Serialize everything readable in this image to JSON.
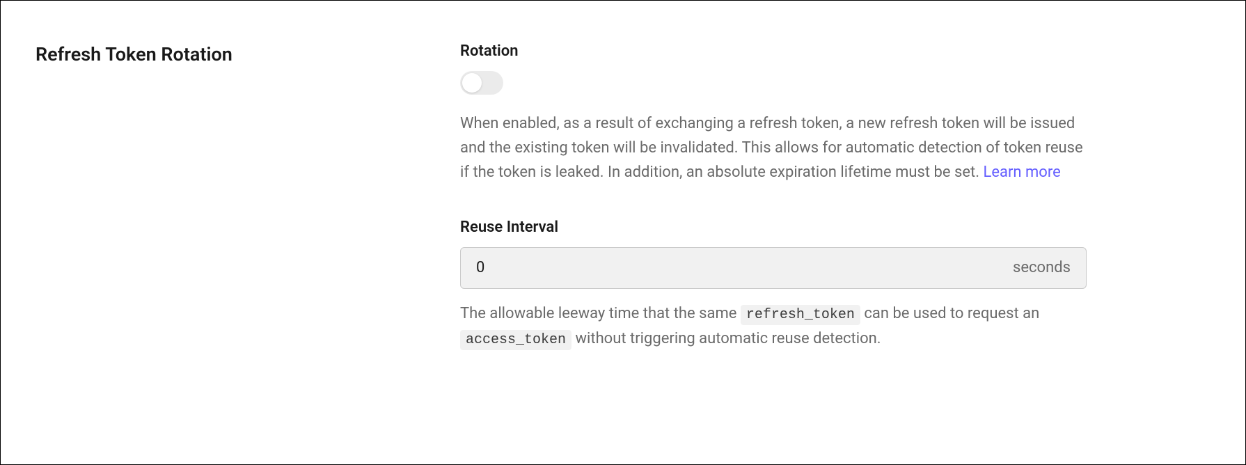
{
  "section": {
    "title": "Refresh Token Rotation"
  },
  "rotation": {
    "label": "Rotation",
    "enabled": false,
    "description": "When enabled, as a result of exchanging a refresh token, a new refresh token will be issued and the existing token will be invalidated. This allows for automatic detection of token reuse if the token is leaked. In addition, an absolute expiration lifetime must be set. ",
    "learn_more_label": "Learn more"
  },
  "reuse_interval": {
    "label": "Reuse Interval",
    "value": "0",
    "unit": "seconds",
    "description_pre": "The allowable leeway time that the same ",
    "token_refresh": "refresh_token",
    "description_mid": " can be used to request an ",
    "token_access": "access_token",
    "description_post": " without triggering automatic reuse detection."
  }
}
